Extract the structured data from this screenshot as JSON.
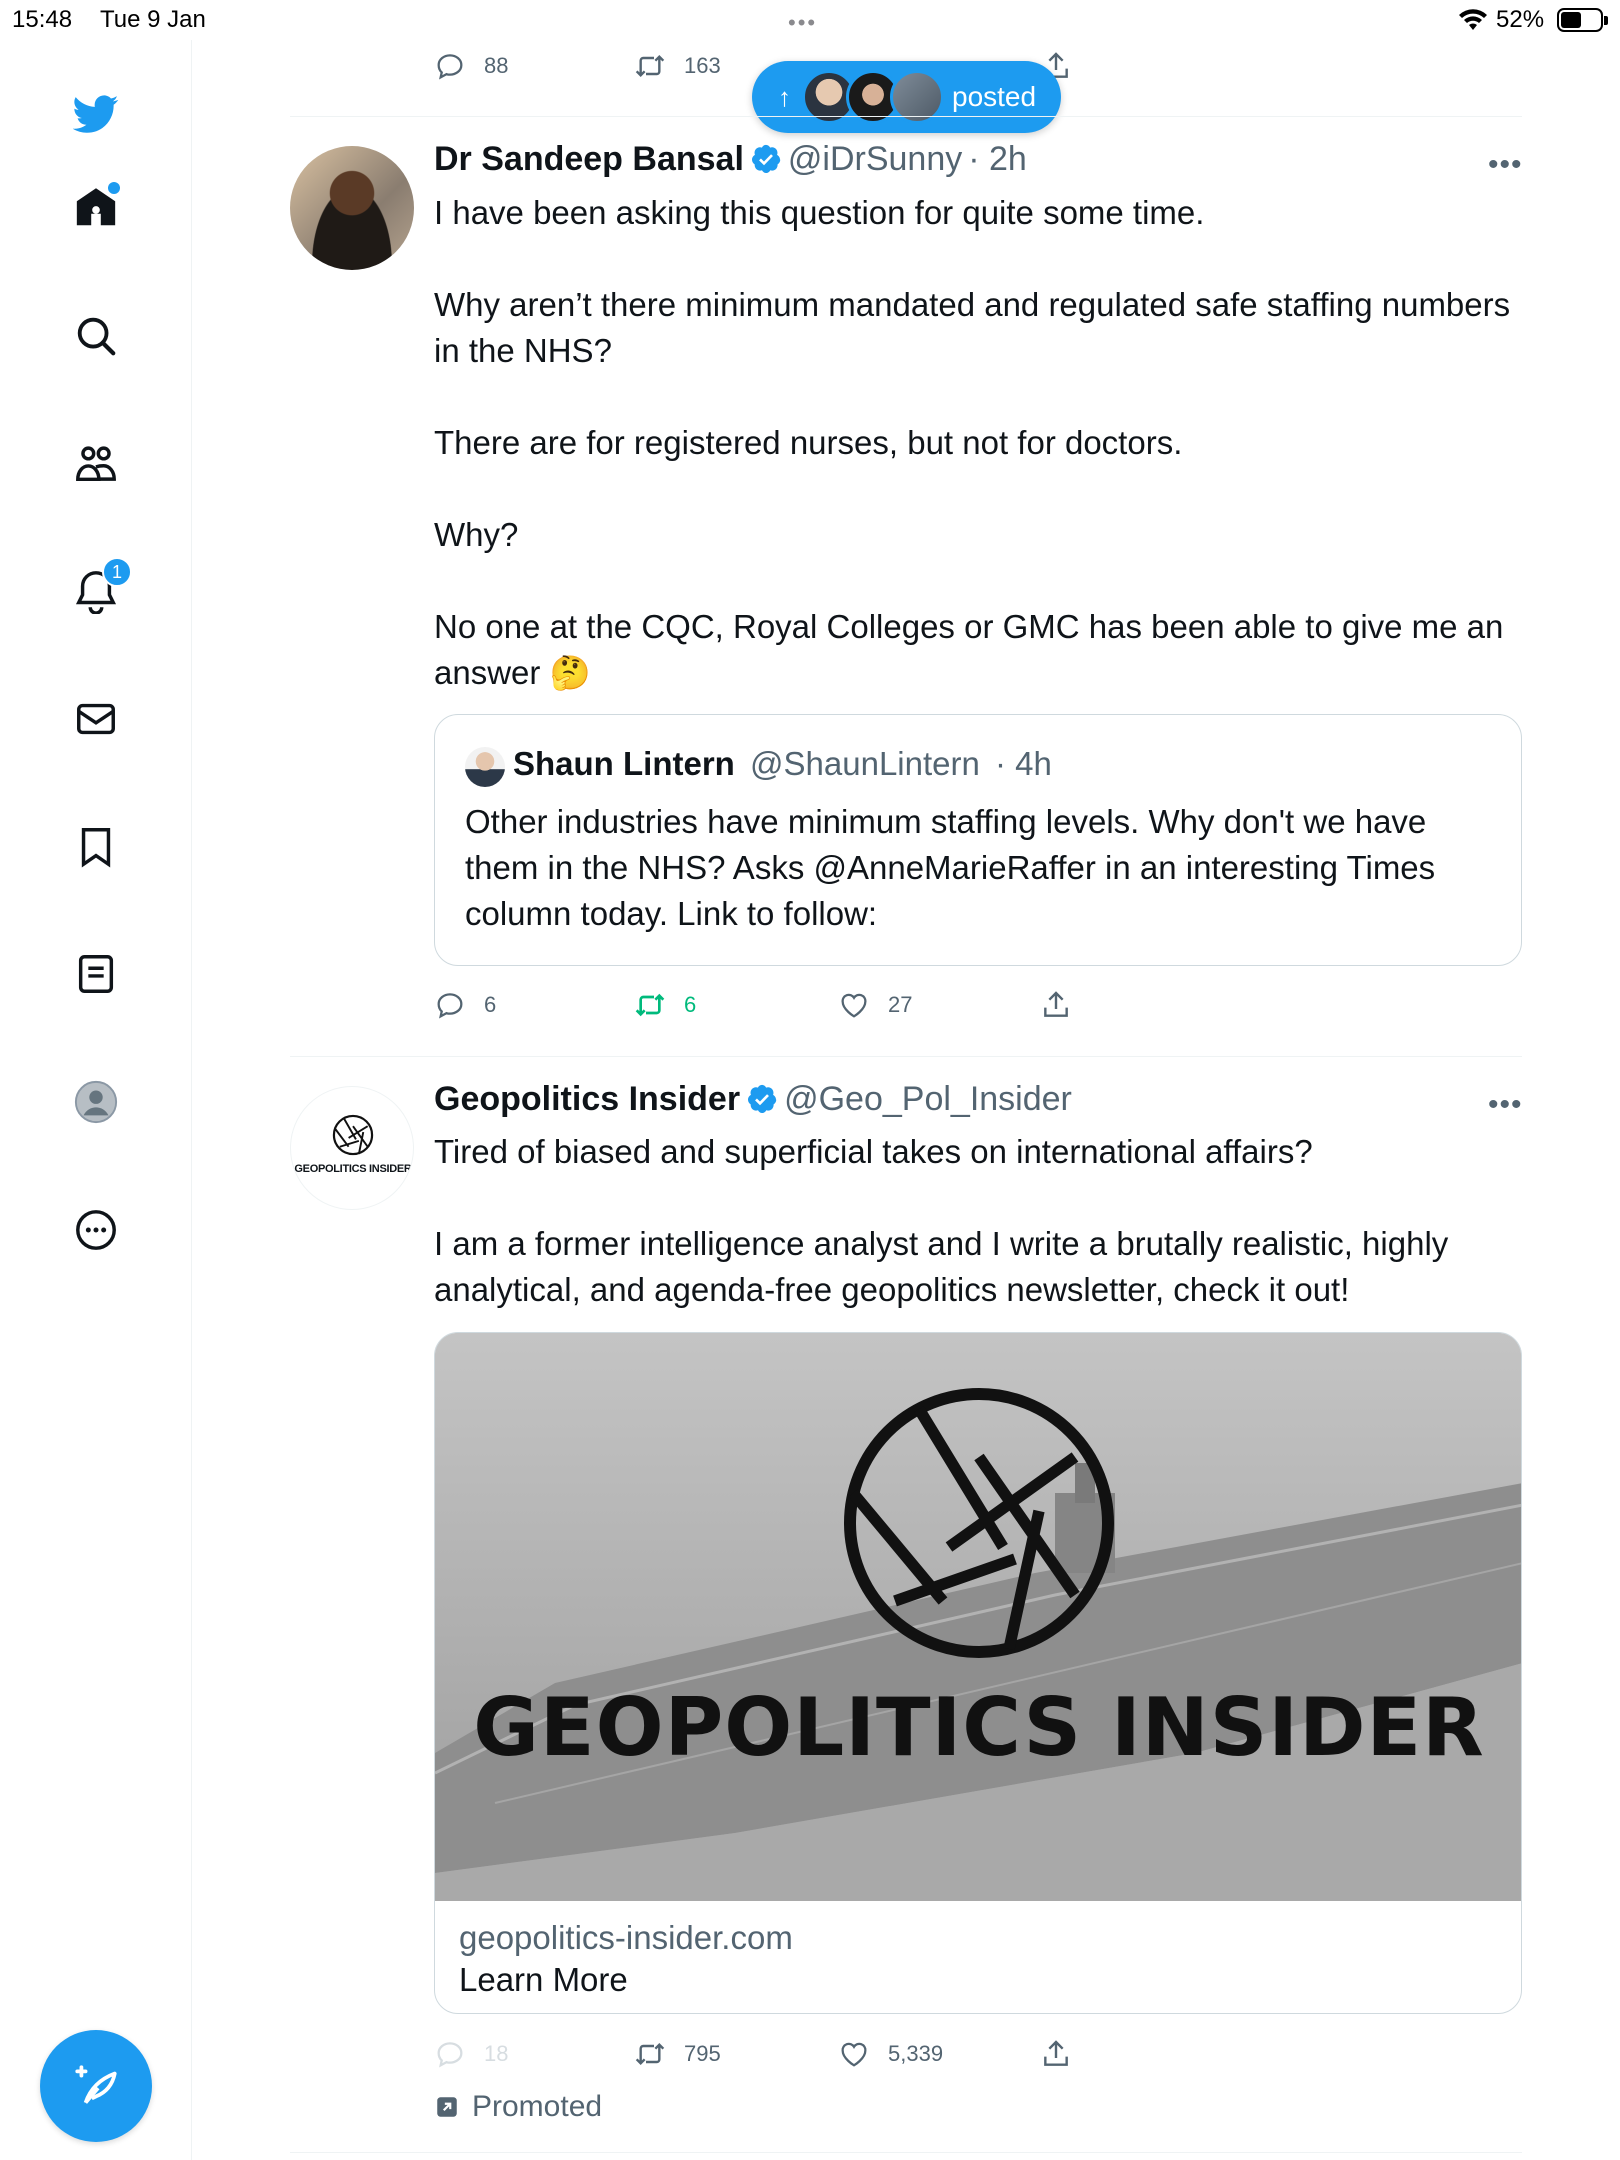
{
  "status_bar": {
    "time": "15:48",
    "date": "Tue 9 Jan",
    "battery": "52%"
  },
  "sidebar": {
    "notification_count": "1"
  },
  "new_posts_pill": {
    "label": "posted"
  },
  "prev_tweet": {
    "replies": "88",
    "retweets": "163"
  },
  "tweet1": {
    "name": "Dr Sandeep Bansal",
    "handle": "@iDrSunny",
    "time": "· 2h",
    "text": "I have been asking this question for quite some time.\n\nWhy aren’t there minimum mandated and regulated safe staffing numbers in the NHS?\n\nThere are for registered nurses, but not for doctors.\n\nWhy?\n\nNo one at the CQC, Royal Colleges or GMC has been able to give me an answer 🤔",
    "quote": {
      "name": "Shaun Lintern",
      "handle": "@ShaunLintern",
      "time": "· 4h",
      "text": "Other industries have minimum staffing levels. Why don't we have them in the NHS? Asks @AnneMarieRaffer in an interesting Times column today. Link to follow:"
    },
    "replies": "6",
    "retweets": "6",
    "likes": "27"
  },
  "tweet2": {
    "name": "Geopolitics Insider",
    "handle": "@Geo_Pol_Insider",
    "avatar_text": "GEOPOLITICS INSIDER",
    "text": "Tired of biased and superficial takes on international affairs?\n\nI am a former intelligence analyst and I write a brutally realistic, highly analytical, and agenda-free geopolitics newsletter, check it out!",
    "card": {
      "image_title": "GEOPOLITICS INSIDER",
      "domain": "geopolitics-insider.com",
      "title": "Learn More"
    },
    "replies": "18",
    "retweets": "795",
    "likes": "5,339",
    "promoted_label": "Promoted"
  },
  "colors": {
    "accent": "#1d9bf0",
    "retweet_active": "#00ba7c",
    "muted": "#536471"
  }
}
